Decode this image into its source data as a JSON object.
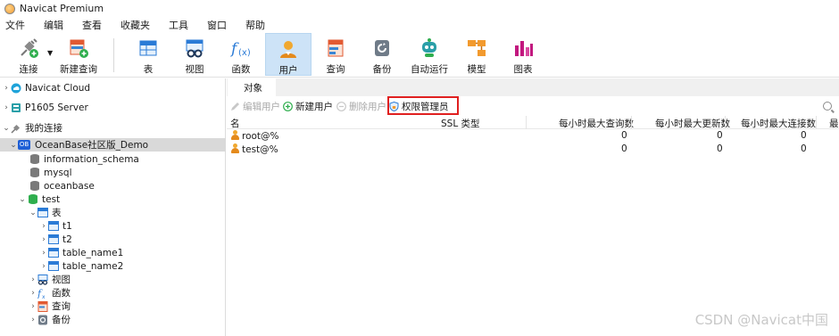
{
  "window": {
    "title": "Navicat Premium"
  },
  "menu": [
    "文件",
    "编辑",
    "查看",
    "收藏夹",
    "工具",
    "窗口",
    "帮助"
  ],
  "toolbar": {
    "connect": "连接",
    "new_query": "新建查询",
    "table": "表",
    "view": "视图",
    "function": "函数",
    "user": "用户",
    "query": "查询",
    "backup": "备份",
    "automation": "自动运行",
    "model": "模型",
    "chart": "图表"
  },
  "tree": {
    "cloud": "Navicat Cloud",
    "server": "P1605 Server",
    "my_connections": "我的连接",
    "connection": "OceanBase社区版_Demo",
    "connection_badge": "OB",
    "databases": [
      "information_schema",
      "mysql",
      "oceanbase"
    ],
    "active_db": "test",
    "tables_group": "表",
    "tables": [
      "t1",
      "t2",
      "table_name1",
      "table_name2"
    ],
    "views": "视图",
    "functions": "函数",
    "queries": "查询",
    "backups": "备份"
  },
  "objects_tab": {
    "label": "对象"
  },
  "obj_toolbar": {
    "edit_user": "编辑用户",
    "new_user": "新建用户",
    "delete_user": "删除用户",
    "privilege_manager": "权限管理员"
  },
  "grid": {
    "columns": [
      "名",
      "SSL 类型",
      "每小时最大查询数",
      "每小时最大更新数",
      "每小时最大连接数",
      "最"
    ],
    "rows": [
      {
        "name": "root@%",
        "ssl": "",
        "q": "0",
        "u": "0",
        "c": "0"
      },
      {
        "name": "test@%",
        "ssl": "",
        "q": "0",
        "u": "0",
        "c": "0"
      }
    ]
  },
  "watermark": "CSDN @Navicat中国"
}
